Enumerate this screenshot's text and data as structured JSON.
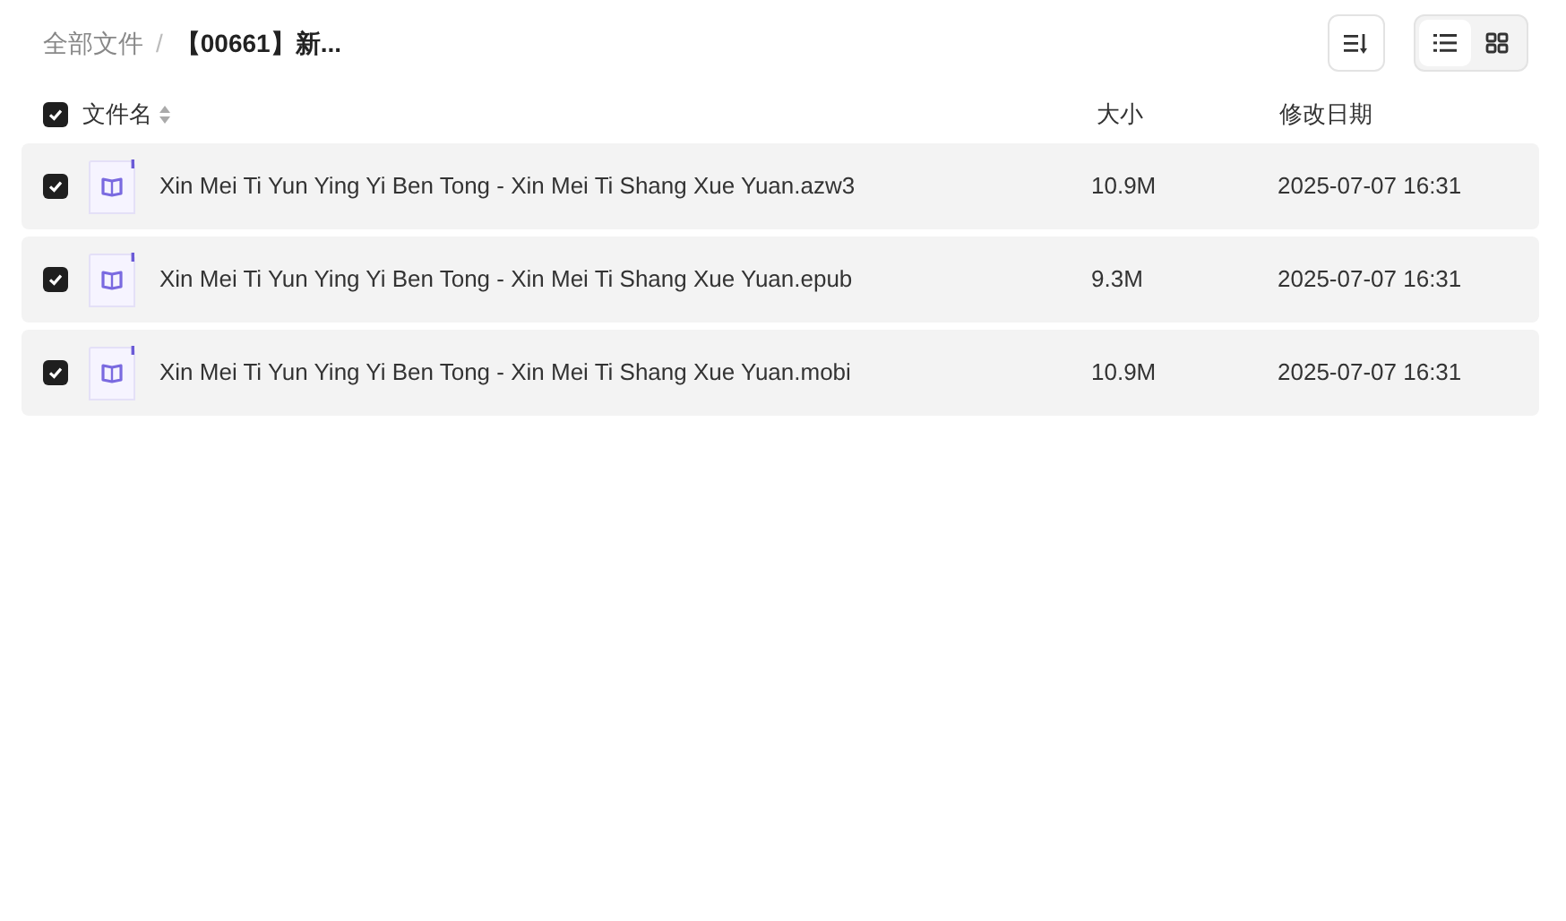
{
  "breadcrumb": [
    {
      "label": "全部文件",
      "current": false
    },
    {
      "label": "【00661】新...",
      "current": true
    }
  ],
  "separator": "/",
  "view_toggle": [
    {
      "kind": "list",
      "selected": true
    },
    {
      "kind": "grid",
      "selected": false
    }
  ],
  "table": {
    "select_all": {
      "checked": true
    },
    "columns": [
      "文件名",
      "大小",
      "修改日期"
    ],
    "rows": [
      {
        "checked": true,
        "name": "Xin Mei Ti Yun Ying Yi Ben Tong - Xin Mei Ti Shang Xue Yuan.azw3",
        "size": "10.9M",
        "modified": "2025-07-07 16:31"
      },
      {
        "checked": true,
        "name": "Xin Mei Ti Yun Ying Yi Ben Tong - Xin Mei Ti Shang Xue Yuan.epub",
        "size": "9.3M",
        "modified": "2025-07-07 16:31"
      },
      {
        "checked": true,
        "name": "Xin Mei Ti Yun Ying Yi Ben Tong - Xin Mei Ti Shang Xue Yuan.mobi",
        "size": "10.9M",
        "modified": "2025-07-07 16:31"
      }
    ]
  }
}
